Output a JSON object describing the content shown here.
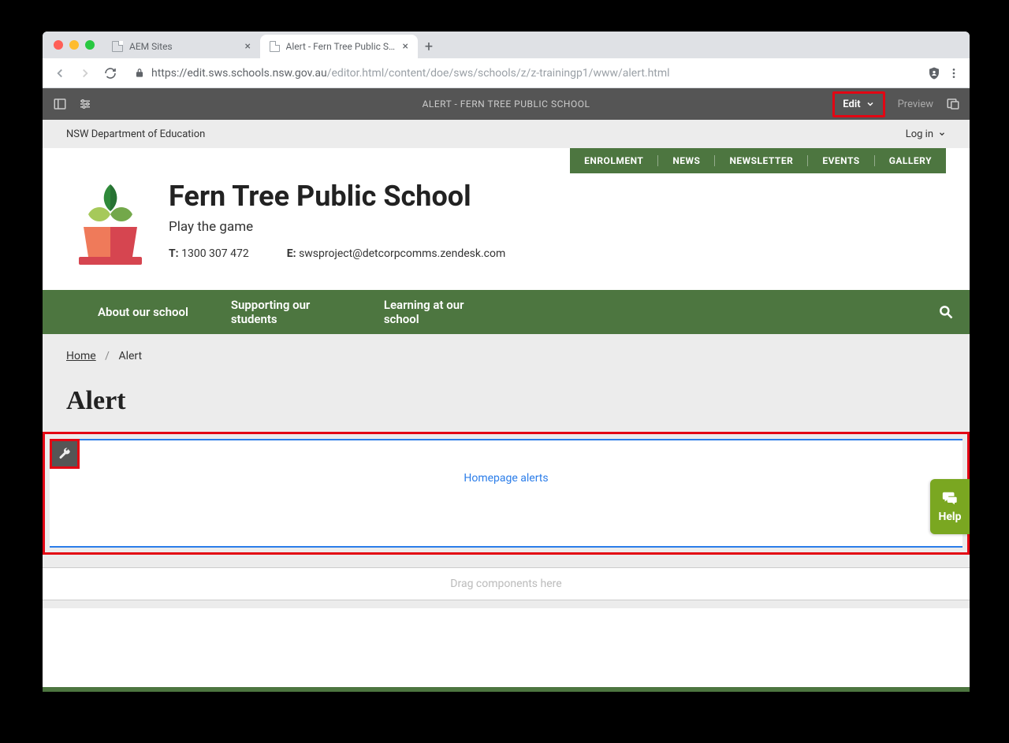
{
  "browser": {
    "tabs": [
      {
        "label": "AEM Sites",
        "active": false
      },
      {
        "label": "Alert - Fern Tree Public School",
        "active": true
      }
    ],
    "url_secure": "https://edit.sws.schools.nsw.gov.au",
    "url_rest": "/editor.html/content/doe/sws/schools/z/z-trainingp1/www/alert.html"
  },
  "aem": {
    "title": "ALERT - FERN TREE PUBLIC SCHOOL",
    "edit_label": "Edit",
    "preview_label": "Preview"
  },
  "dept": {
    "name": "NSW Department of Education",
    "login": "Log in"
  },
  "topnav": {
    "items": [
      "ENROLMENT",
      "NEWS",
      "NEWSLETTER",
      "EVENTS",
      "GALLERY"
    ]
  },
  "school": {
    "name": "Fern Tree Public School",
    "tagline": "Play the game",
    "phone_label": "T:",
    "phone": "1300 307 472",
    "email_label": "E:",
    "email": "swsproject@detcorpcomms.zendesk.com"
  },
  "mainnav": {
    "items": [
      "About our school",
      "Supporting our students",
      "Learning at our school"
    ]
  },
  "breadcrumb": {
    "home": "Home",
    "current": "Alert"
  },
  "page": {
    "title": "Alert",
    "alert_placeholder": "Homepage alerts",
    "drag_placeholder": "Drag components here"
  },
  "help": {
    "label": "Help"
  }
}
